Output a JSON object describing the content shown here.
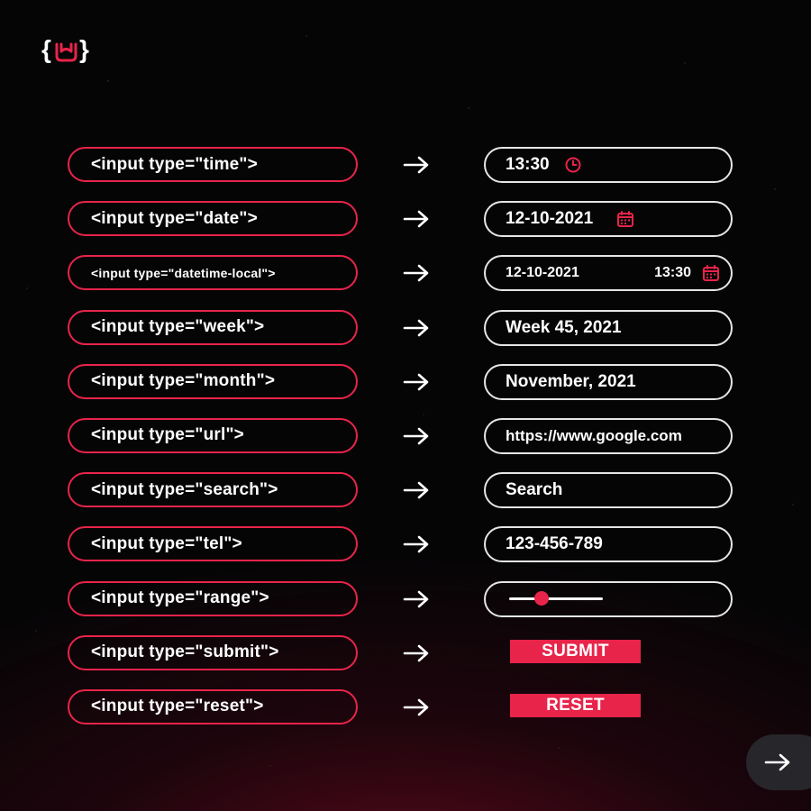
{
  "logo": {
    "icon": "rock-hand-braces-logo-icon"
  },
  "colors": {
    "accent": "#e8244a",
    "text": "#ffffff",
    "background": "#050506"
  },
  "rows": [
    {
      "code": "<input type=\"time\">",
      "value": "13:30",
      "icon": "clock-icon"
    },
    {
      "code": "<input type=\"date\">",
      "value": "12-10-2021",
      "icon": "calendar-icon"
    },
    {
      "code": "<input type=\"datetime-local\">",
      "date": "12-10-2021",
      "time": "13:30",
      "icon": "calendar-icon"
    },
    {
      "code": "<input type=\"week\">",
      "value": "Week 45, 2021"
    },
    {
      "code": "<input type=\"month\">",
      "value": "November, 2021"
    },
    {
      "code": "<input type=\"url\">",
      "value": "https://www.google.com"
    },
    {
      "code": "<input type=\"search\">",
      "placeholder": "Search"
    },
    {
      "code": "<input type=\"tel\">",
      "value": "123-456-789"
    },
    {
      "code": "<input type=\"range\">",
      "value_fraction": 0.35
    },
    {
      "code": "<input type=\"submit\">",
      "label": "SUBMIT"
    },
    {
      "code": "<input type=\"reset\">",
      "label": "RESET"
    }
  ],
  "next": {
    "icon": "arrow-right-icon"
  }
}
